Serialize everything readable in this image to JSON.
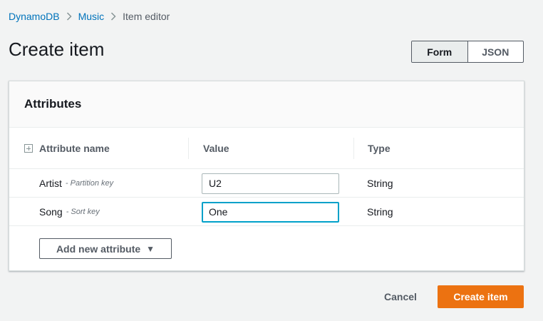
{
  "breadcrumb": {
    "items": [
      {
        "label": "DynamoDB"
      },
      {
        "label": "Music"
      },
      {
        "label": "Item editor"
      }
    ],
    "separator": ">"
  },
  "page": {
    "title": "Create item"
  },
  "view_toggle": {
    "options": [
      {
        "label": "Form",
        "active": true
      },
      {
        "label": "JSON",
        "active": false
      }
    ]
  },
  "attributes_panel": {
    "title": "Attributes",
    "columns": {
      "name": "Attribute name",
      "value": "Value",
      "type": "Type"
    },
    "rows": [
      {
        "name": "Artist",
        "key_label": "- Partition key",
        "value": "U2",
        "type": "String"
      },
      {
        "name": "Song",
        "key_label": "- Sort key",
        "value": "One",
        "type": "String",
        "focused": true
      }
    ],
    "add_button": {
      "label": "Add new attribute",
      "caret": "▼"
    }
  },
  "footer": {
    "cancel_label": "Cancel",
    "create_label": "Create item"
  },
  "colors": {
    "link": "#0073bb",
    "primary_button": "#ec7211",
    "focus_ring": "#00a1c9",
    "background": "#f2f3f3"
  },
  "icons": {
    "separator": "chevron-right-icon",
    "expand": "expand-plus-icon",
    "caret": "caret-down-icon"
  }
}
